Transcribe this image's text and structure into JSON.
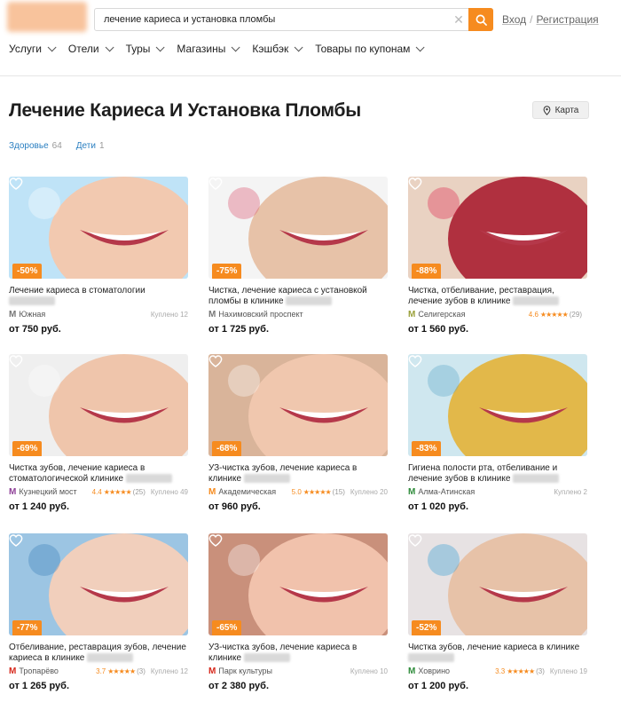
{
  "header": {
    "search_value": "лечение кариеса и установка пломбы",
    "login": "Вход",
    "register": "Регистрация"
  },
  "nav": [
    "Услуги",
    "Отели",
    "Туры",
    "Магазины",
    "Кэшбэк",
    "Товары по купонам"
  ],
  "page": {
    "title": "Лечение Кариеса И Установка Пломбы",
    "map_button": "Карта",
    "filters": [
      {
        "label": "Здоровье",
        "count": "64"
      },
      {
        "label": "Дети",
        "count": "1"
      }
    ]
  },
  "colors": {
    "accent": "#f68b1f",
    "link": "#2a7fc1"
  },
  "cards": [
    {
      "discount": "-50%",
      "title": "Лечение кариеса в стоматологии",
      "metro": "Южная",
      "metro_color": "#777777",
      "rating": "",
      "stars": "",
      "reviews": "",
      "bought": "Куплено 12",
      "price": "от 750 руб."
    },
    {
      "discount": "-75%",
      "title": "Чистка, лечение кариеса с установкой пломбы в клинике",
      "metro": "Нахимовский проспект",
      "metro_color": "#777777",
      "rating": "",
      "stars": "",
      "reviews": "",
      "bought": "",
      "price": "от 1 725 руб."
    },
    {
      "discount": "-88%",
      "title": "Чистка, отбеливание, реставрация, лечение зубов в клинике",
      "metro": "Селигерская",
      "metro_color": "#9aa03a",
      "rating": "4.6",
      "stars": "★★★★★",
      "reviews": "(29)",
      "bought": "",
      "price": "от 1 560 руб."
    },
    {
      "discount": "-69%",
      "title": "Чистка зубов, лечение кариеса в стоматологической клинике",
      "metro": "Кузнецкий мост",
      "metro_color": "#8e3f97",
      "rating": "4.4",
      "stars": "★★★★★",
      "reviews": "(25)",
      "bought": "Куплено 49",
      "price": "от 1 240 руб."
    },
    {
      "discount": "-68%",
      "title": "УЗ-чистка зубов, лечение кариеса в клинике",
      "metro": "Академическая",
      "metro_color": "#f68b1f",
      "rating": "5.0",
      "stars": "★★★★★",
      "reviews": "(15)",
      "bought": "Куплено 20",
      "price": "от 960 руб."
    },
    {
      "discount": "-83%",
      "title": "Гигиена полости рта, отбеливание и лечение зубов в клинике",
      "metro": "Алма-Атинская",
      "metro_color": "#2e8b3a",
      "rating": "",
      "stars": "",
      "reviews": "",
      "bought": "Куплено 2",
      "price": "от 1 020 руб."
    },
    {
      "discount": "-77%",
      "title": "Отбеливание, реставрация зубов, лечение кариеса в клинике",
      "metro": "Тропарёво",
      "metro_color": "#d6281b",
      "rating": "3.7",
      "stars": "★★★★★",
      "reviews": "(3)",
      "bought": "Куплено 12",
      "price": "от 1 265 руб."
    },
    {
      "discount": "-65%",
      "title": "УЗ-чистка зубов, лечение кариеса в клинике",
      "metro": "Парк культуры",
      "metro_color": "#d6281b",
      "rating": "",
      "stars": "",
      "reviews": "",
      "bought": "Куплено 10",
      "price": "от 2 380 руб."
    },
    {
      "discount": "-52%",
      "title": "Чистка зубов, лечение кариеса в клинике",
      "metro": "Ховрино",
      "metro_color": "#2e8b3a",
      "rating": "3.3",
      "stars": "★★★★★",
      "reviews": "(3)",
      "bought": "Куплено 19",
      "price": "от 1 200 руб."
    }
  ]
}
